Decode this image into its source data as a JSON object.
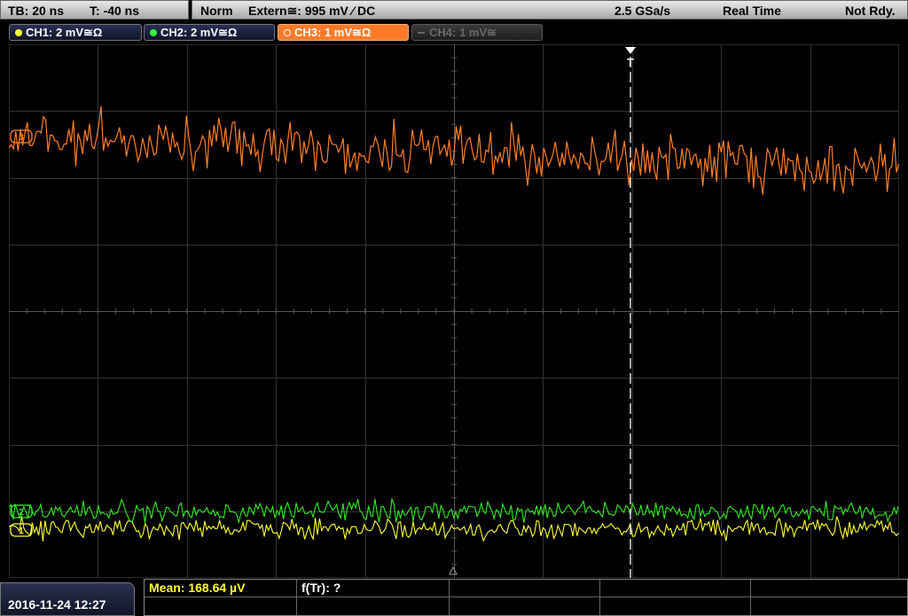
{
  "header": {
    "timebase": "TB: 20 ns",
    "trigger_time": "T: -40 ns",
    "mode": "Norm",
    "trigger_source": "Extern≅: 995 mV ⁄ DC",
    "sample_rate": "2.5 GSa/s",
    "acq_mode": "Real Time",
    "status": "Not Rdy."
  },
  "channels": [
    {
      "label": "CH1: 2 mV≅Ω",
      "color": "#ffff33",
      "state": "on"
    },
    {
      "label": "CH2: 2 mV≅Ω",
      "color": "#33ff33",
      "state": "on"
    },
    {
      "label": "CH3: 1 mV≅Ω",
      "color": "#ff8c2a",
      "state": "active"
    },
    {
      "label": "CH4: 1 mV≅",
      "color": "#777777",
      "state": "off"
    }
  ],
  "trigger_marker": "T",
  "footer": {
    "datetime": "2016-11-24 12:27",
    "measurement_mean": "Mean: 168.64 µV",
    "measurement_freq": "f(Tr): ?"
  },
  "colors": {
    "ch1": "#ffff33",
    "ch2": "#33ff33",
    "ch3": "#ff7f24",
    "grid": "#3a3a3a"
  }
}
